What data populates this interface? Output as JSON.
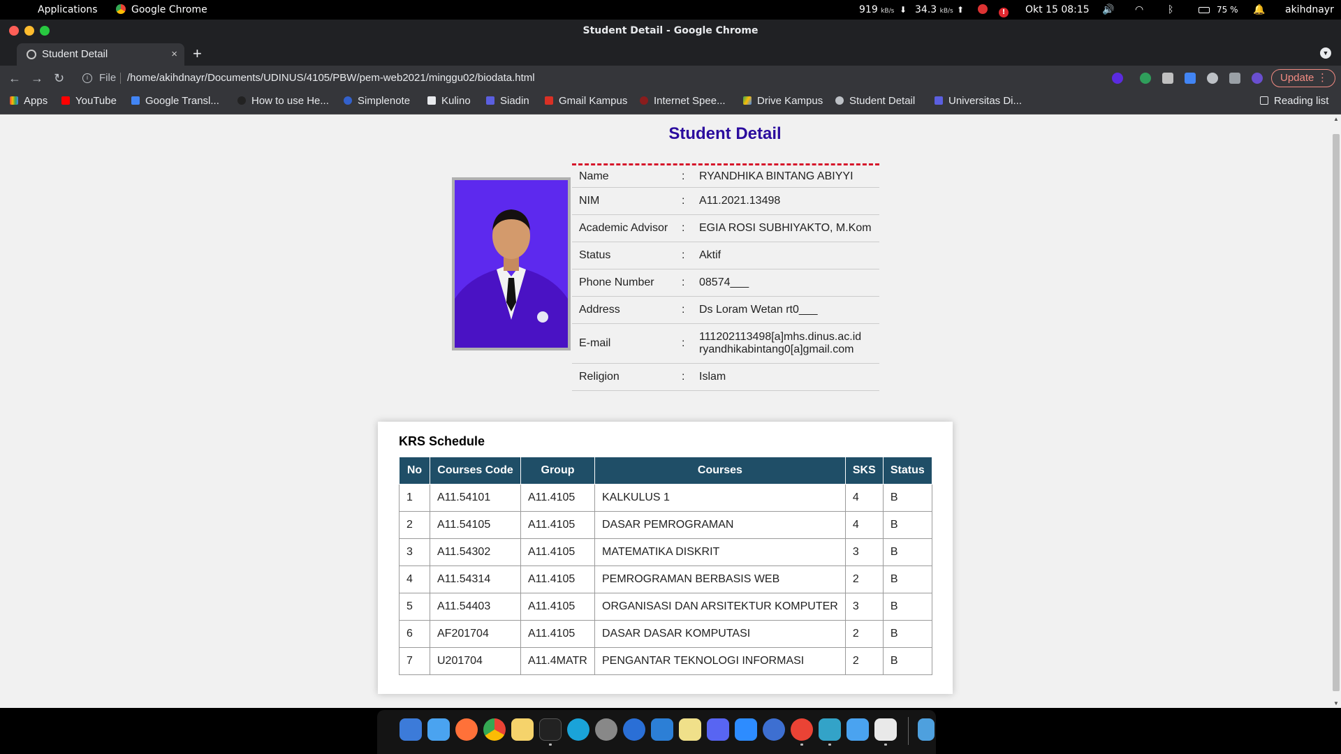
{
  "os": {
    "apple_glyph": "",
    "menu_applications": "Applications",
    "active_app": "Google Chrome",
    "net_up_value": "919",
    "net_up_unit": "kB/s",
    "net_down_value": "34.3",
    "net_down_unit": "kB/s",
    "datetime": "Okt 15  08:15",
    "battery": "75 %",
    "username": "akihdnayr"
  },
  "browser": {
    "window_title": "Student Detail - Google Chrome",
    "tab_title": "Student Detail",
    "tab_close": "×",
    "new_tab": "+",
    "file_label": "File",
    "url": "/home/akihdnayr/Documents/UDINUS/4105/PBW/pem-web2021/minggu02/biodata.html",
    "update_label": "Update",
    "bookmarks": [
      {
        "label": "Apps",
        "icon": "apps-grid-icon",
        "color": "#ea4335"
      },
      {
        "label": "YouTube",
        "icon": "youtube-icon",
        "color": "#ff0000"
      },
      {
        "label": "Google Transl...",
        "icon": "translate-icon",
        "color": "#4285f4"
      },
      {
        "label": "How to use He...",
        "icon": "github-icon",
        "color": "#222222"
      },
      {
        "label": "Simplenote",
        "icon": "simplenote-icon",
        "color": "#3361cc"
      },
      {
        "label": "Kulino",
        "icon": "kulino-icon",
        "color": "#e8eaed"
      },
      {
        "label": "Siadin",
        "icon": "siadin-icon",
        "color": "#5b5fe0"
      },
      {
        "label": "Gmail Kampus",
        "icon": "gmail-icon",
        "color": "#d93025"
      },
      {
        "label": "Internet Spee...",
        "icon": "speedtest-icon",
        "color": "#8a1d1d"
      },
      {
        "label": "Drive Kampus",
        "icon": "drive-icon",
        "color": "#fbbc04"
      },
      {
        "label": "Student Detail",
        "icon": "globe-icon",
        "color": "#bdc1c6"
      },
      {
        "label": "Universitas Di...",
        "icon": "university-icon",
        "color": "#5b5fe0"
      }
    ],
    "reading_list": "Reading list"
  },
  "page": {
    "title": "Student Detail",
    "photo_alt": "student-photo",
    "details": [
      {
        "label": "Name",
        "colon": ":",
        "value": "RYANDHIKA BINTANG ABIYYI"
      },
      {
        "label": "NIM",
        "colon": ":",
        "value": "A11.2021.13498"
      },
      {
        "label": "Academic Advisor",
        "colon": ":",
        "value": "EGIA ROSI SUBHIYAKTO, M.Kom"
      },
      {
        "label": "Status",
        "colon": ":",
        "value": "Aktif"
      },
      {
        "label": "Phone Number",
        "colon": ":",
        "value": "08574___"
      },
      {
        "label": "Address",
        "colon": ":",
        "value": "Ds Loram Wetan rt0___"
      },
      {
        "label": "E-mail",
        "colon": ":",
        "value": "111202113498[a]mhs.dinus.ac.id",
        "value2": "ryandhikabintang0[a]gmail.com"
      },
      {
        "label": "Religion",
        "colon": ":",
        "value": "Islam"
      }
    ],
    "krs": {
      "title": "KRS Schedule",
      "headers": [
        "No",
        "Courses Code",
        "Group",
        "Courses",
        "SKS",
        "Status"
      ],
      "rows": [
        [
          "1",
          "A11.54101",
          "A11.4105",
          "KALKULUS 1",
          "4",
          "B"
        ],
        [
          "2",
          "A11.54105",
          "A11.4105",
          "DASAR PEMROGRAMAN",
          "4",
          "B"
        ],
        [
          "3",
          "A11.54302",
          "A11.4105",
          "MATEMATIKA DISKRIT",
          "3",
          "B"
        ],
        [
          "4",
          "A11.54314",
          "A11.4105",
          "PEMROGRAMAN BERBASIS WEB",
          "2",
          "B"
        ],
        [
          "5",
          "A11.54403",
          "A11.4105",
          "ORGANISASI DAN ARSITEKTUR KOMPUTER",
          "3",
          "B"
        ],
        [
          "6",
          "AF201704",
          "A11.4105",
          "DASAR DASAR KOMPUTASI",
          "2",
          "B"
        ],
        [
          "7",
          "U201704",
          "A11.4MATR",
          "PENGANTAR TEKNOLOGI INFORMASI",
          "2",
          "B"
        ]
      ]
    }
  },
  "colors": {
    "title": "#2b0c9e",
    "dashed_border": "#d6162b",
    "table_header": "#1f4e67",
    "photo_bg": "#5d29ee"
  },
  "dock": [
    {
      "name": "launcher-icon",
      "color": "#3c7bd9"
    },
    {
      "name": "finder-icon",
      "color": "#4aa3f0"
    },
    {
      "name": "firefox-icon",
      "color": "#ff7139"
    },
    {
      "name": "chrome-icon",
      "color": "#34a853"
    },
    {
      "name": "notes-icon",
      "color": "#f5d36b"
    },
    {
      "name": "terminal-icon",
      "color": "#222222"
    },
    {
      "name": "browser-icon",
      "color": "#1aa3d9"
    },
    {
      "name": "settings-icon",
      "color": "#888888"
    },
    {
      "name": "writer-icon",
      "color": "#2a6fd6"
    },
    {
      "name": "vscode-icon",
      "color": "#2c7fd6"
    },
    {
      "name": "sticky-icon",
      "color": "#f0e08a"
    },
    {
      "name": "discord-icon",
      "color": "#5865f2"
    },
    {
      "name": "zoom-icon",
      "color": "#2d8cff"
    },
    {
      "name": "help-icon",
      "color": "#3d6fd1"
    },
    {
      "name": "chrome-alt-icon",
      "color": "#ea4335"
    },
    {
      "name": "vpn-icon",
      "color": "#33a3c8"
    },
    {
      "name": "finder-alt-icon",
      "color": "#4aa3f0"
    },
    {
      "name": "textedit-icon",
      "color": "#e9e9e9"
    },
    {
      "name": "files-icon",
      "color": "#4ea0de"
    }
  ]
}
